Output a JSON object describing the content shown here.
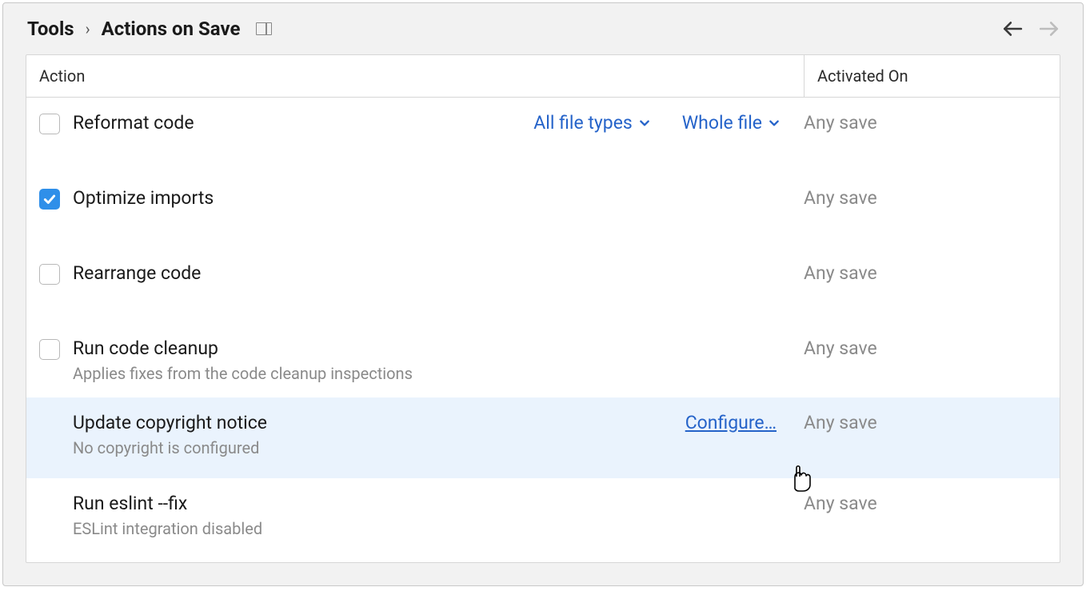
{
  "breadcrumb": {
    "parent": "Tools",
    "current": "Actions on Save"
  },
  "columns": {
    "action": "Action",
    "activated": "Activated On"
  },
  "rows": {
    "reformat": {
      "label": "Reformat code",
      "opt_filetypes": "All file types",
      "opt_scope": "Whole file",
      "activated": "Any save"
    },
    "optimize": {
      "label": "Optimize imports",
      "activated": "Any save"
    },
    "rearrange": {
      "label": "Rearrange code",
      "activated": "Any save"
    },
    "cleanup": {
      "label": "Run code cleanup",
      "sub": "Applies fixes from the code cleanup inspections",
      "activated": "Any save"
    },
    "copyright": {
      "label": "Update copyright notice",
      "sub": "No copyright is configured",
      "link": "Configure…",
      "activated": "Any save"
    },
    "eslint": {
      "label": "Run eslint --fix",
      "sub": "ESLint integration disabled",
      "activated": "Any save"
    }
  }
}
